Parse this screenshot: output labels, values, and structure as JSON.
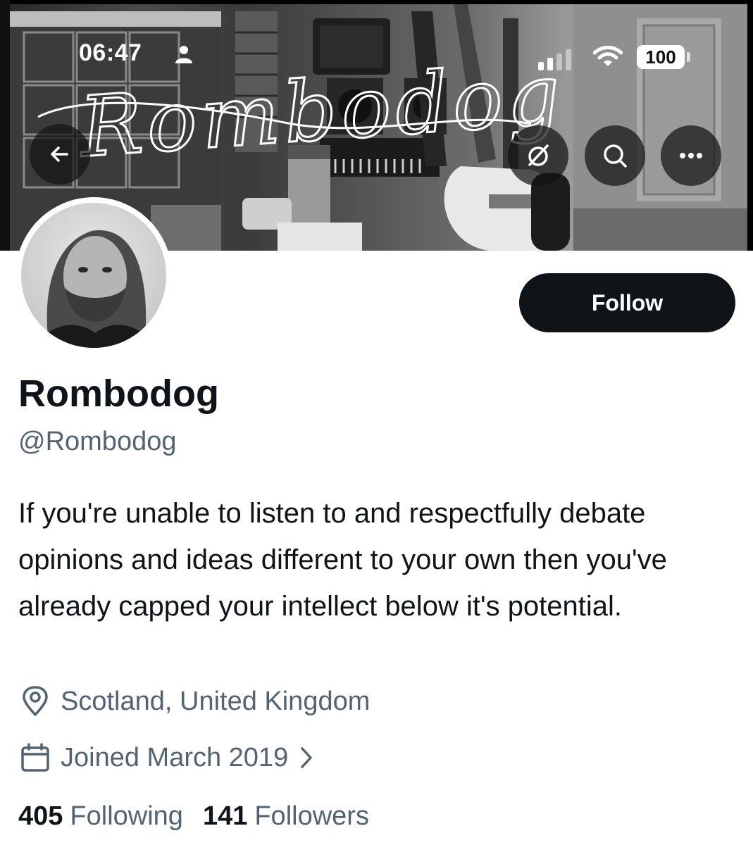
{
  "status_bar": {
    "time": "06:47",
    "battery": "100"
  },
  "banner": {
    "signature_text": "Rombodog"
  },
  "header_buttons": {
    "back_icon": "arrow-left-icon",
    "grok_icon": "slashed-circle-icon",
    "search_icon": "search-icon",
    "more_icon": "more-horizontal-icon"
  },
  "profile": {
    "follow_label": "Follow",
    "display_name": "Rombodog",
    "handle": "@Rombodog",
    "bio": "If you're unable to listen to and respectfully debate opinions and ideas different to your own then you've already capped your intellect below it's potential.",
    "location": "Scotland, United Kingdom",
    "joined": "Joined March 2019",
    "following_count": "405",
    "following_label": "Following",
    "followers_count": "141",
    "followers_label": "Followers"
  },
  "colors": {
    "text_primary": "#0f1419",
    "text_secondary": "#536471",
    "follow_bg": "#0f1419"
  }
}
